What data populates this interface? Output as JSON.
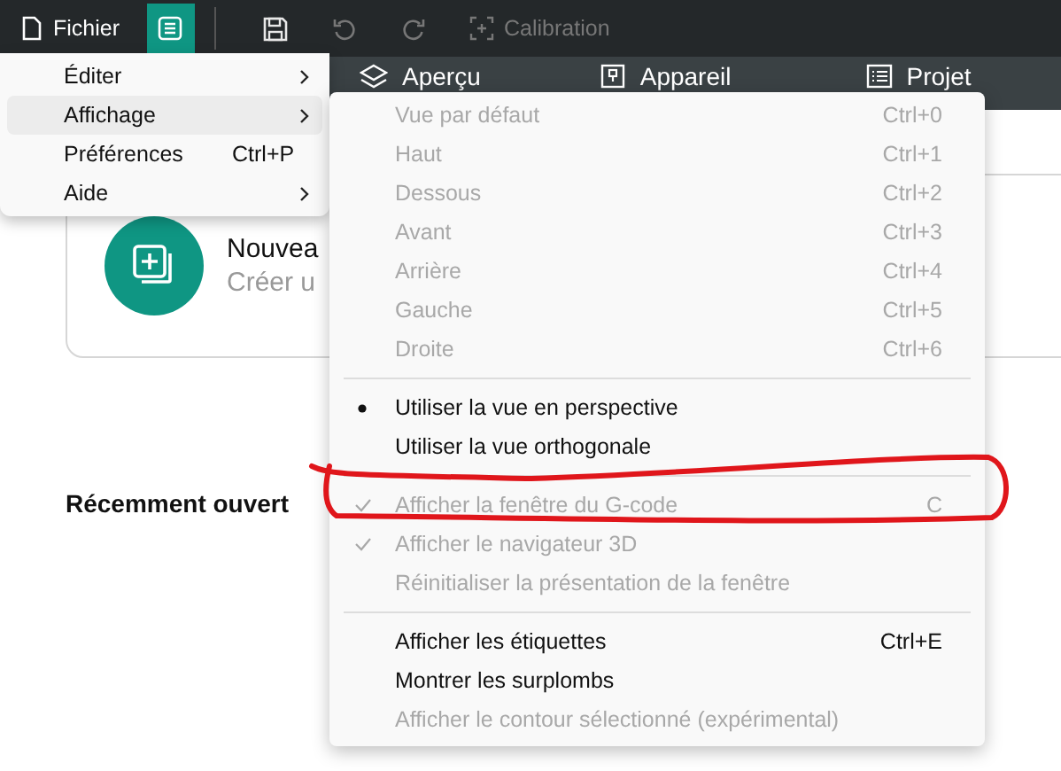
{
  "toolbar": {
    "file_menu": {
      "label": "Fichier"
    },
    "menu_button": {
      "selected": true
    },
    "buttons": [
      {
        "kind": "save",
        "disabled": false
      },
      {
        "kind": "undo",
        "disabled": true
      },
      {
        "kind": "redo",
        "disabled": true
      },
      {
        "kind": "calibration",
        "label": "Calibration",
        "disabled": true
      }
    ]
  },
  "tabs": [
    {
      "kind": "layers",
      "label": "Aperçu"
    },
    {
      "kind": "device",
      "label": "Appareil"
    },
    {
      "kind": "list",
      "label": "Projet"
    }
  ],
  "start_card": {
    "title": "Nouvea",
    "subtitle": "Créer u"
  },
  "recent": {
    "heading": "Récemment ouvert"
  },
  "main_menu": [
    {
      "label": "Éditer",
      "submenu": true,
      "selected": false
    },
    {
      "label": "Affichage",
      "submenu": true,
      "selected": true
    },
    {
      "label": "Préférences",
      "shortcut": "Ctrl+P",
      "submenu": false,
      "selected": false
    },
    {
      "label": "Aide",
      "submenu": true,
      "selected": false
    }
  ],
  "view_menu": [
    [
      {
        "kind": "plain",
        "label": "Vue par défaut",
        "shortcut": "Ctrl+0",
        "disabled": true
      },
      {
        "kind": "plain",
        "label": "Haut",
        "shortcut": "Ctrl+1",
        "disabled": true
      },
      {
        "kind": "plain",
        "label": "Dessous",
        "shortcut": "Ctrl+2",
        "disabled": true
      },
      {
        "kind": "plain",
        "label": "Avant",
        "shortcut": "Ctrl+3",
        "disabled": true
      },
      {
        "kind": "plain",
        "label": "Arrière",
        "shortcut": "Ctrl+4",
        "disabled": true
      },
      {
        "kind": "plain",
        "label": "Gauche",
        "shortcut": "Ctrl+5",
        "disabled": true
      },
      {
        "kind": "plain",
        "label": "Droite",
        "shortcut": "Ctrl+6",
        "disabled": true
      }
    ],
    [
      {
        "kind": "radio",
        "label": "Utiliser la vue en perspective",
        "checked": true,
        "disabled": false
      },
      {
        "kind": "radio",
        "label": "Utiliser la vue orthogonale",
        "checked": false,
        "disabled": false
      }
    ],
    [
      {
        "kind": "check",
        "label": "Afficher la fenêtre du G-code",
        "shortcut": "C",
        "checked": true,
        "disabled": true
      },
      {
        "kind": "check",
        "label": "Afficher le navigateur 3D",
        "checked": true,
        "disabled": true
      },
      {
        "kind": "plain",
        "label": "Réinitialiser la présentation de la fenêtre",
        "disabled": true
      }
    ],
    [
      {
        "kind": "plain",
        "label": "Afficher les étiquettes",
        "shortcut": "Ctrl+E",
        "disabled": false
      },
      {
        "kind": "plain",
        "label": "Montrer les surplombs",
        "disabled": false
      },
      {
        "kind": "plain",
        "label": "Afficher le contour sélectionné (expérimental)",
        "disabled": true
      }
    ]
  ],
  "annotations": [
    {
      "kind": "freehand-loop"
    }
  ]
}
